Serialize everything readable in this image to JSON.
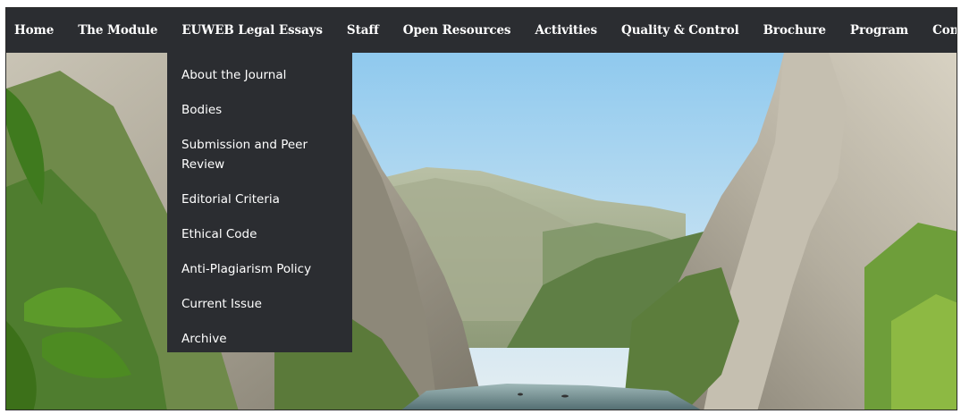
{
  "nav": {
    "items": [
      {
        "label": "Home"
      },
      {
        "label": "The Module"
      },
      {
        "label": "EUWEB Legal Essays"
      },
      {
        "label": "Staff"
      },
      {
        "label": "Open Resources"
      },
      {
        "label": "Activities"
      },
      {
        "label": "Quality & Control"
      },
      {
        "label": "Brochure"
      },
      {
        "label": "Program"
      },
      {
        "label": "Contacts"
      }
    ],
    "active_item": "EUWEB Legal Essays"
  },
  "dropdown": {
    "items": [
      {
        "label": "About the Journal"
      },
      {
        "label": "Bodies"
      },
      {
        "label": "Submission and Peer Review"
      },
      {
        "label": "Editorial Criteria"
      },
      {
        "label": "Ethical Code"
      },
      {
        "label": "Anti-Plagiarism Policy"
      },
      {
        "label": "Current Issue"
      },
      {
        "label": "Archive"
      }
    ]
  },
  "colors": {
    "nav_background": "#2b2d31",
    "nav_text": "#ffffff"
  }
}
